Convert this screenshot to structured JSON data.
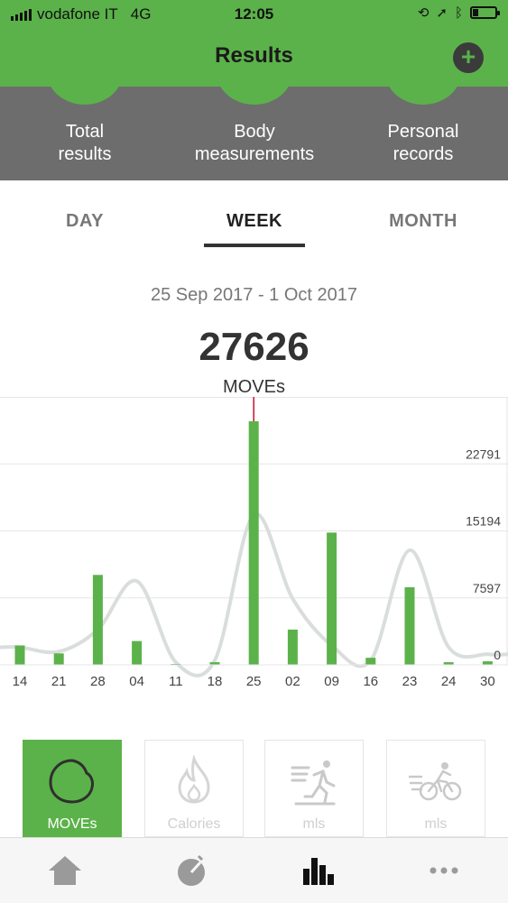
{
  "status": {
    "carrier": "vodafone IT",
    "network": "4G",
    "time": "12:05"
  },
  "header": {
    "title": "Results",
    "add_icon": "plus-icon"
  },
  "categories": [
    {
      "label": "Total\nresults"
    },
    {
      "label": "Body\nmeasurements"
    },
    {
      "label": "Personal\nrecords"
    }
  ],
  "tabs": [
    {
      "label": "DAY",
      "active": false
    },
    {
      "label": "WEEK",
      "active": true
    },
    {
      "label": "MONTH",
      "active": false
    }
  ],
  "summary": {
    "date_range": "25 Sep 2017 - 1 Oct 2017",
    "value": "27626",
    "unit": "MOVEs"
  },
  "chart_data": {
    "type": "bar",
    "categories": [
      "14",
      "21",
      "28",
      "04",
      "11",
      "18",
      "25",
      "02",
      "09",
      "16",
      "23",
      "24",
      "30"
    ],
    "values": [
      2200,
      1300,
      10200,
      2700,
      0,
      300,
      27626,
      4000,
      15000,
      800,
      8800,
      300,
      400
    ],
    "trend": [
      2000,
      1500,
      4000,
      9500,
      300,
      500,
      17000,
      7500,
      2200,
      500,
      13000,
      2000,
      1200
    ],
    "yticks": [
      "0",
      "7597",
      "15194",
      "22791"
    ],
    "ylim": [
      0,
      30388
    ],
    "selected_index": 6,
    "colors": {
      "bar": "#5bb24a",
      "trend": "#d9dedd",
      "grid": "#e6e6e6",
      "marker": "#c8102e"
    }
  },
  "metrics": [
    {
      "label": "MOVEs",
      "icon": "moves-icon",
      "active": true
    },
    {
      "label": "Calories",
      "icon": "flame-icon",
      "active": false
    },
    {
      "label": "mls",
      "icon": "running-icon",
      "active": false
    },
    {
      "label": "mls",
      "icon": "cycling-icon",
      "active": false
    }
  ],
  "tabbar": [
    {
      "icon": "home-icon"
    },
    {
      "icon": "speedometer-icon"
    },
    {
      "icon": "bar-chart-icon"
    },
    {
      "icon": "more-icon"
    }
  ]
}
